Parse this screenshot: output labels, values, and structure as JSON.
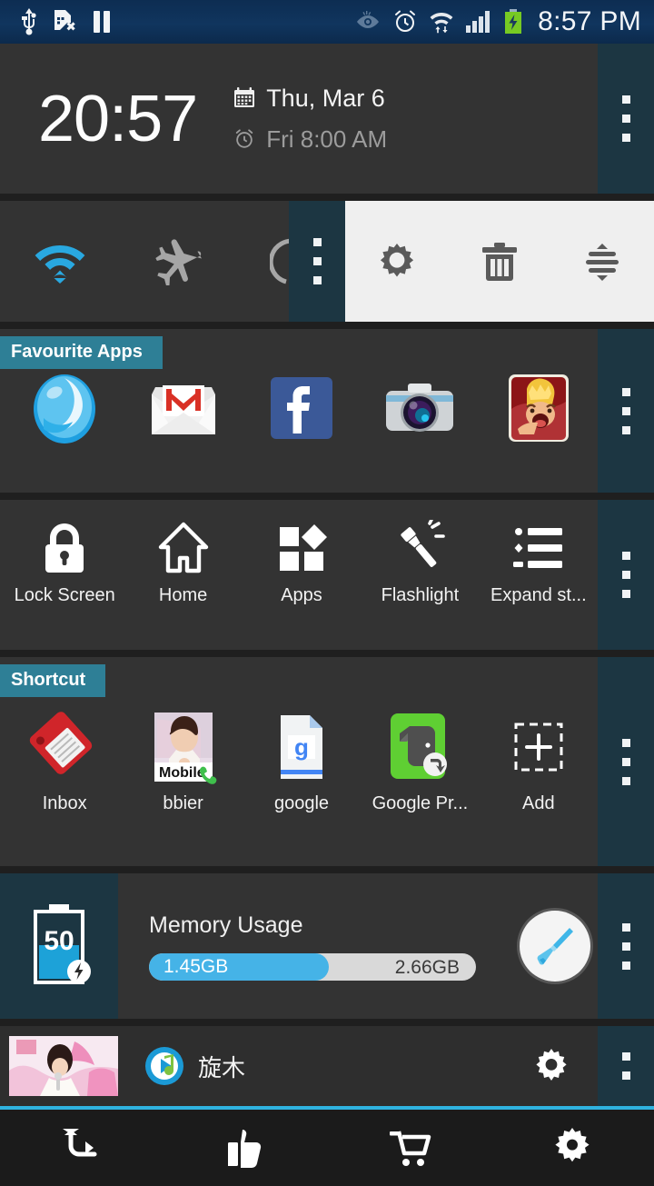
{
  "statusbar": {
    "left_icons": [
      "usb-icon",
      "sim-card-missing-icon",
      "pause-icon"
    ],
    "right_icons": [
      "smart-stay-eye-icon",
      "alarm-clock-icon",
      "wifi-transfer-icon",
      "signal-bars-icon",
      "battery-charging-icon"
    ],
    "time": "8:57 PM"
  },
  "clock": {
    "time": "20:57",
    "date": "Thu, Mar 6",
    "alarm": "Fri 8:00 AM",
    "calendar_icon": "calendar-icon",
    "alarm_icon": "alarm-clock-icon",
    "handle_icon": "drag-handle-dots-icon"
  },
  "toggles": {
    "items": [
      {
        "name": "wifi-toggle",
        "icon": "wifi-icon",
        "state": "on"
      },
      {
        "name": "airplane-toggle",
        "icon": "airplane-icon",
        "state": "off"
      },
      {
        "name": "bluetooth-toggle",
        "icon": "bluetooth-icon",
        "state": "off"
      }
    ],
    "overlay": {
      "handle_icon": "drag-handle-dots-icon",
      "actions": [
        {
          "name": "settings-action",
          "icon": "gear-icon"
        },
        {
          "name": "delete-action",
          "icon": "trash-icon"
        },
        {
          "name": "sort-action",
          "icon": "sliders-icon"
        }
      ]
    }
  },
  "favourite_apps": {
    "header": "Favourite Apps",
    "items": [
      {
        "label": "",
        "icon": "boat-browser-icon"
      },
      {
        "label": "",
        "icon": "gmail-icon"
      },
      {
        "label": "",
        "icon": "facebook-icon"
      },
      {
        "label": "",
        "icon": "camera-icon"
      },
      {
        "label": "",
        "icon": "clash-of-clans-icon"
      }
    ]
  },
  "tools": {
    "items": [
      {
        "label": "Lock Screen",
        "icon": "lock-icon"
      },
      {
        "label": "Home",
        "icon": "home-icon"
      },
      {
        "label": "Apps",
        "icon": "apps-grid-icon"
      },
      {
        "label": "Flashlight",
        "icon": "flashlight-icon"
      },
      {
        "label": "Expand st...",
        "icon": "list-icon"
      }
    ]
  },
  "shortcut": {
    "header": "Shortcut",
    "items": [
      {
        "label": "Inbox",
        "icon": "tag-label-icon"
      },
      {
        "label": "bbier",
        "icon": "contact-photo-icon",
        "badge": "Mobile"
      },
      {
        "label": "google",
        "icon": "google-docs-icon"
      },
      {
        "label": "Google Pr...",
        "icon": "evernote-shortcut-icon"
      },
      {
        "label": "Add",
        "icon": "add-plus-icon"
      }
    ]
  },
  "memory": {
    "battery_level": "50",
    "battery_icon": "battery-charging-icon",
    "title": "Memory Usage",
    "used": "1.45GB",
    "total": "2.66GB",
    "used_percent": 55,
    "clean_icon": "broom-icon"
  },
  "notification": {
    "album_art_icon": "album-art-thumbnail",
    "app_icon": "music-player-icon",
    "title": "旋木",
    "settings_icon": "gear-icon"
  },
  "bottombar": {
    "items": [
      {
        "name": "back-button",
        "icon": "back-arrow-icon"
      },
      {
        "name": "like-button",
        "icon": "thumbs-up-icon"
      },
      {
        "name": "store-button",
        "icon": "shopping-cart-icon"
      },
      {
        "name": "settings-button",
        "icon": "gear-icon"
      }
    ]
  },
  "colors": {
    "accent_teal": "#2e7f96",
    "handle_teal": "#1c3642",
    "blue": "#45b3e7",
    "panel_bg": "#333333"
  }
}
